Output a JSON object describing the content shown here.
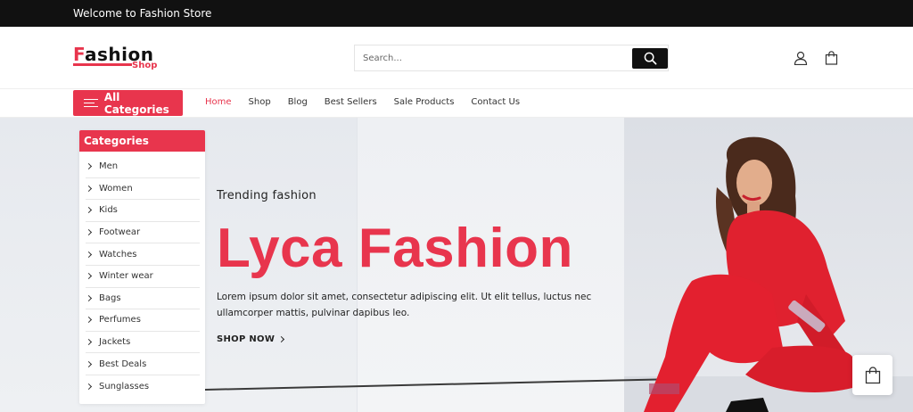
{
  "topbar": {
    "welcome": "Welcome to Fashion Store"
  },
  "header": {
    "logo": {
      "main_first": "F",
      "main_rest": "ashion",
      "sub": "Shop"
    },
    "search": {
      "placeholder": "Search...",
      "value": ""
    },
    "icons": {
      "search": "search-icon",
      "user": "user-icon",
      "cart": "shopping-bag-icon"
    }
  },
  "nav": {
    "all_categories": "All Categories",
    "links": [
      {
        "label": "Home",
        "active": true
      },
      {
        "label": "Shop",
        "active": false
      },
      {
        "label": "Blog",
        "active": false
      },
      {
        "label": "Best Sellers",
        "active": false
      },
      {
        "label": "Sale Products",
        "active": false
      },
      {
        "label": "Contact Us",
        "active": false
      }
    ]
  },
  "categories": {
    "title": "Categories",
    "items": [
      "Men",
      "Women",
      "Kids",
      "Footwear",
      "Watches",
      "Winter wear",
      "Bags",
      "Perfumes",
      "Jackets",
      "Best Deals",
      "Sunglasses"
    ]
  },
  "hero": {
    "subtitle": "Trending fashion",
    "title": "Lyca Fashion",
    "description": "Lorem ipsum dolor sit amet, consectetur adipiscing elit. Ut elit tellus, luctus nec ullamcorper mattis, pulvinar dapibus leo.",
    "cta": "SHOP NOW"
  },
  "colors": {
    "accent": "#e8354d",
    "dark": "#111111"
  }
}
